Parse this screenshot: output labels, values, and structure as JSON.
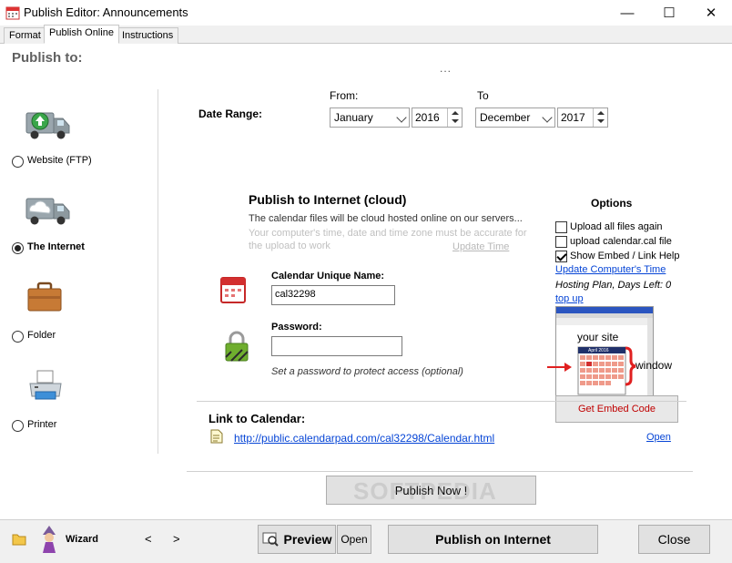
{
  "window": {
    "title": "Publish Editor: Announcements",
    "minimize": "—",
    "maximize": "☐",
    "close": "✕"
  },
  "tabs": [
    {
      "label": "Format",
      "active": false
    },
    {
      "label": "Publish Online",
      "active": true
    },
    {
      "label": "Instructions",
      "active": false
    }
  ],
  "left": {
    "heading": "Publish to:",
    "options": [
      {
        "label": "Website (FTP)",
        "selected": false,
        "icon": "ftp-truck-icon"
      },
      {
        "label": "The Internet",
        "selected": true,
        "icon": "cloud-truck-icon"
      },
      {
        "label": "Folder",
        "selected": false,
        "icon": "folder-briefcase-icon"
      },
      {
        "label": "Printer",
        "selected": false,
        "icon": "printer-icon"
      }
    ]
  },
  "top_dots": "...",
  "date_range": {
    "label": "Date Range:",
    "from_label": "From:",
    "to_label": "To",
    "from_month": "January",
    "from_year": "2016",
    "to_month": "December",
    "to_year": "2017"
  },
  "cloud": {
    "heading": "Publish to Internet (cloud)",
    "description": "The calendar files will be cloud hosted online on our servers...",
    "note": "Your computer's time, date and time zone must be accurate for the upload to work",
    "update_time": "Update Time",
    "unique_name_label": "Calendar Unique Name:",
    "unique_name_value": "cal32298",
    "password_label": "Password:",
    "password_value": "",
    "password_hint": "Set a password to protect access (optional)"
  },
  "options": {
    "title": "Options",
    "checkboxes": [
      {
        "label": "Upload all files again",
        "checked": false
      },
      {
        "label": "upload calendar.cal file",
        "checked": false
      },
      {
        "label": "Show Embed / Link Help",
        "checked": true
      }
    ],
    "update_computer_time": "Update Computer's Time",
    "hosting_plan": "Hosting Plan, Days Left: 0",
    "top_up": "top up",
    "your_site": "your site",
    "window_label": "window",
    "get_embed_code": "Get Embed Code",
    "mini_cal_month": "April 2016"
  },
  "link": {
    "heading": "Link to Calendar:",
    "url": "http://public.calendarpad.com/cal32298/Calendar.html",
    "open": "Open"
  },
  "publish_now": "Publish Now !",
  "watermark": "SOFTPEDIA",
  "bottom": {
    "wizard": "Wizard",
    "prev": "<",
    "next": ">",
    "preview": "Preview",
    "open": "Open",
    "publish_internet": "Publish on Internet",
    "close": "Close"
  },
  "colors": {
    "link": "#0645d6",
    "embed_button_text": "#c00000",
    "accent_red": "#e02020"
  }
}
